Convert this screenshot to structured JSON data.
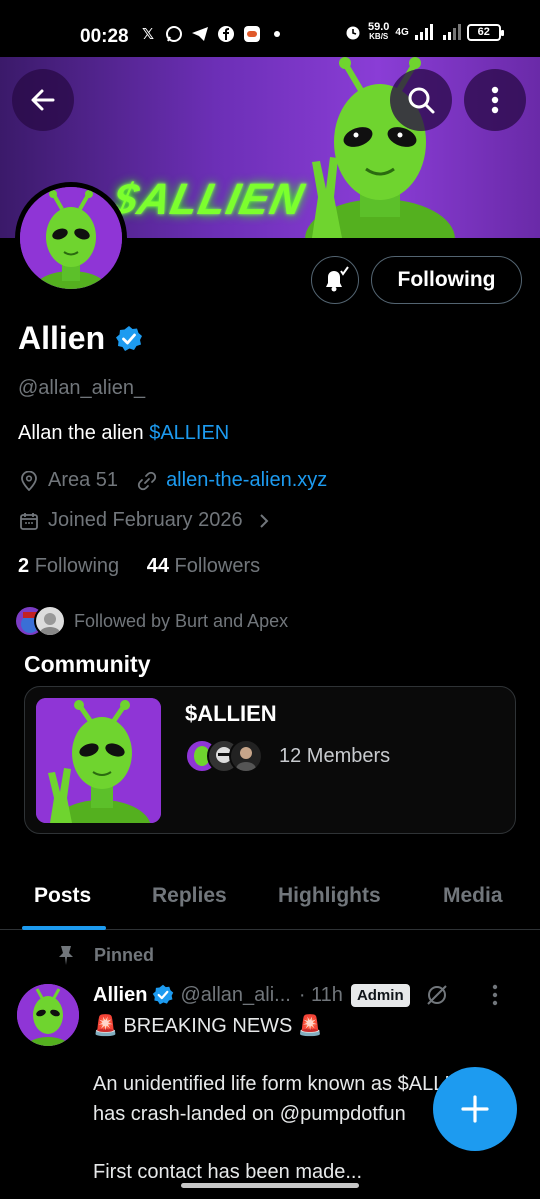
{
  "statusbar": {
    "time": "00:28",
    "speed_top": "59.0",
    "speed_bottom": "KB/S",
    "network": "4G",
    "battery": "62"
  },
  "banner": {
    "title": "$ALLIEN"
  },
  "header": {
    "following_label": "Following"
  },
  "profile": {
    "name": "Allien",
    "handle": "@allan_alien_",
    "bio_text": "Allan the alien ",
    "bio_cashtag": "$ALLIEN",
    "location": "Area 51",
    "website": "allen-the-alien.xyz",
    "joined": "Joined February 2026",
    "following_count": "2",
    "following_label": "Following",
    "followers_count": "44",
    "followers_label": "Followers",
    "followed_by": "Followed by Burt and Apex"
  },
  "community": {
    "section_title": "Community",
    "name": "$ALLIEN",
    "members": "12 Members"
  },
  "tabs": [
    "Posts",
    "Replies",
    "Highlights",
    "Media"
  ],
  "post": {
    "pinned_label": "Pinned",
    "author": "Allien",
    "handle": "@allan_ali...",
    "time": "· 11h",
    "badge": "Admin",
    "line1": "🚨 BREAKING NEWS 🚨",
    "line2": "An unidentified life form known as $ALLIEN",
    "line3": "has crash-landed on @pumpdotfun",
    "line4": "First contact has been made..."
  },
  "colors": {
    "accent": "#1d9bf0",
    "background": "#000000",
    "alien_green": "#7cff2e",
    "banner_purple": "#7a34c4"
  }
}
